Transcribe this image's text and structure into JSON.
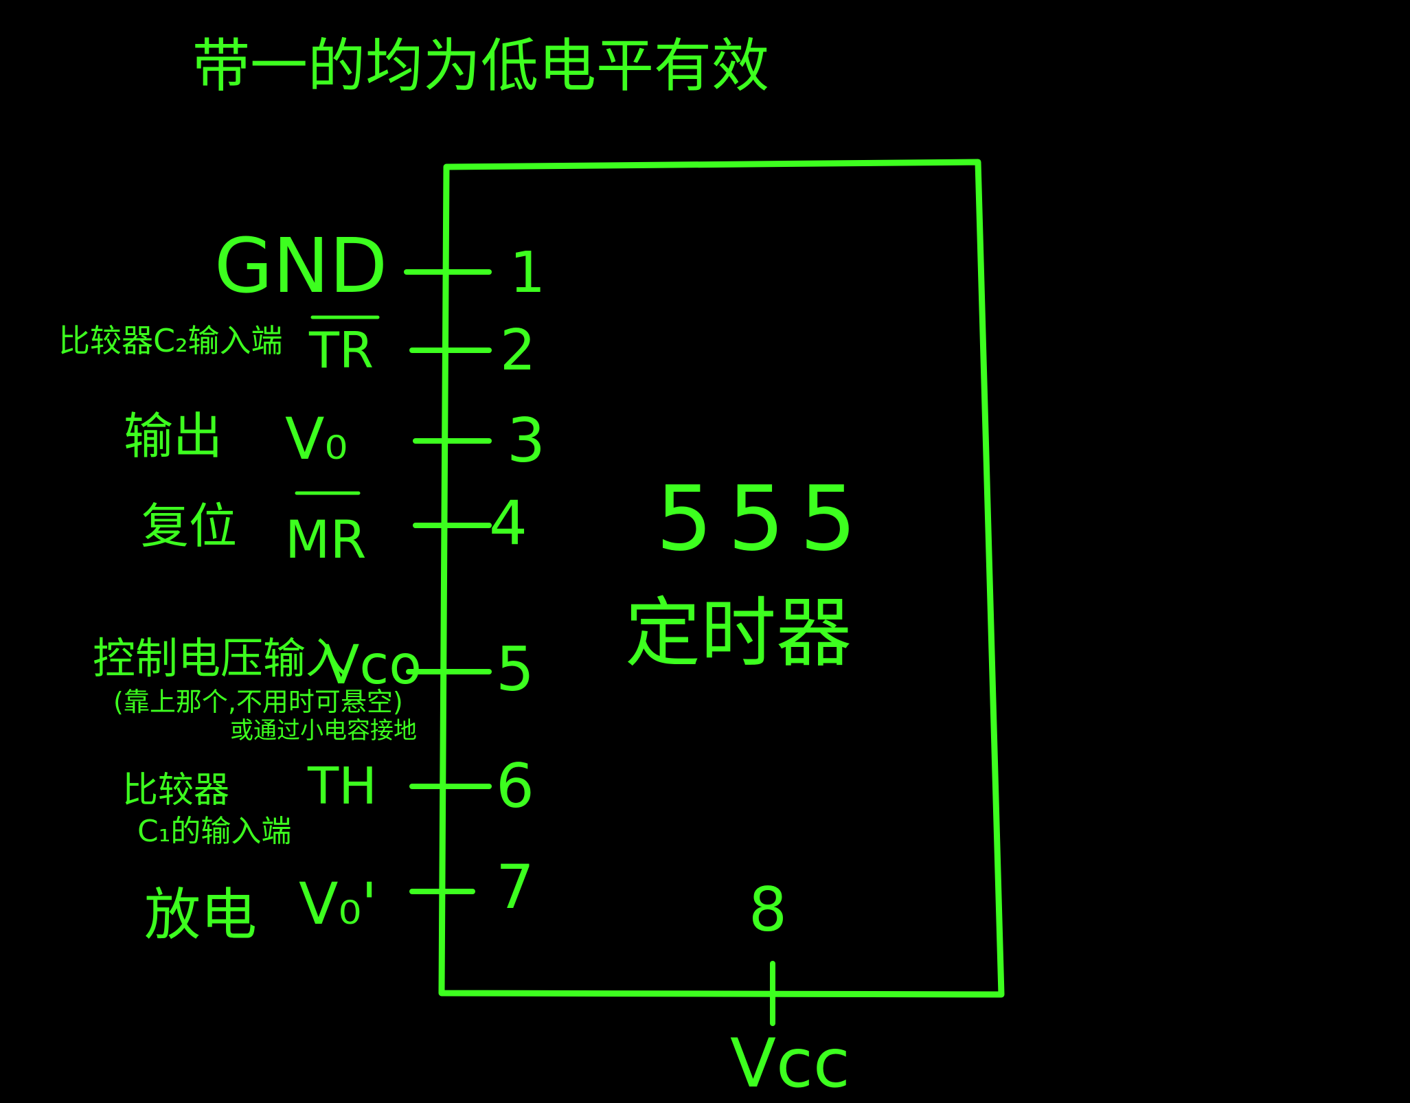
{
  "title": "带一的均为低电平有效",
  "chip": {
    "name": "555",
    "subtitle": "定时器"
  },
  "pins": [
    {
      "number": "1",
      "signal": "GND",
      "desc": ""
    },
    {
      "number": "2",
      "signal": "TR",
      "desc": "比较器C₂输入端"
    },
    {
      "number": "3",
      "signal": "V₀",
      "desc": "输出"
    },
    {
      "number": "4",
      "signal": "MR",
      "desc": "复位"
    },
    {
      "number": "5",
      "signal": "Vco",
      "desc": "控制电压输入",
      "note1": "(靠上那个,不用时可悬空)",
      "note2": "或通过小电容接地"
    },
    {
      "number": "6",
      "signal": "TH",
      "desc": "比较器",
      "desc2": "C₁的输入端"
    },
    {
      "number": "7",
      "signal": "V₀'",
      "desc": "放电"
    },
    {
      "number": "8",
      "signal": "Vcc",
      "desc": ""
    }
  ],
  "colors": {
    "ink": "#3dff1f",
    "background": "#000000"
  }
}
